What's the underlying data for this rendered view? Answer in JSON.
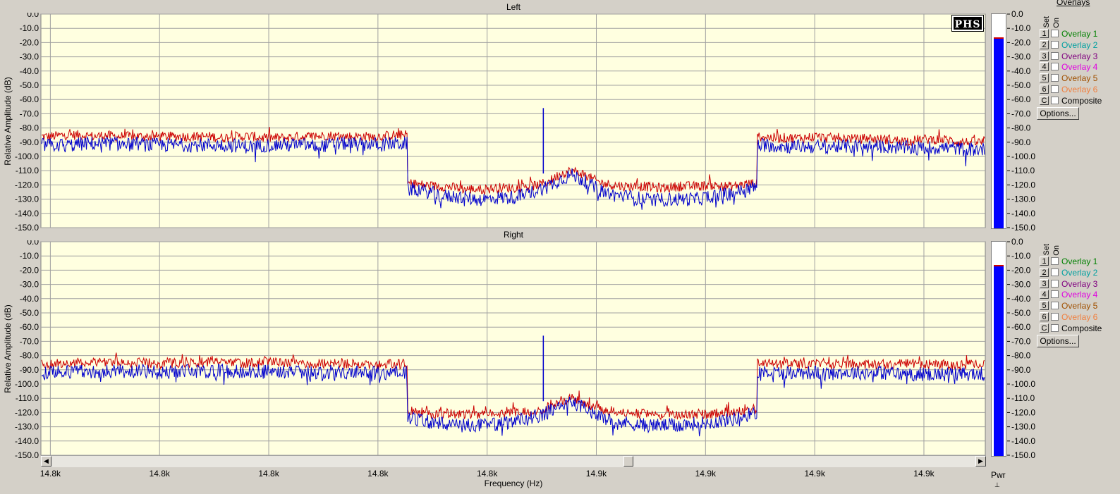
{
  "chart_data": [
    {
      "type": "line",
      "title": "Left",
      "ylabel": "Relative Amplitude (dB)",
      "ylim": [
        -150,
        0
      ],
      "yticks": [
        "0.0",
        "-10.0",
        "-20.0",
        "-30.0",
        "-40.0",
        "-50.0",
        "-60.0",
        "-70.0",
        "-80.0",
        "-90.0",
        "-100.0",
        "-110.0",
        "-120.0",
        "-130.0",
        "-140.0",
        "-150.0"
      ],
      "grid": true,
      "background": "#ffffe0",
      "series": [
        {
          "color": "#cc0000",
          "values": [
            -86,
            -86,
            -85,
            -85,
            -85,
            -86,
            -85,
            -86,
            -86,
            -86,
            -86,
            -86,
            -86,
            -86,
            -86,
            -86,
            -86,
            -87,
            -86,
            -86,
            -86,
            -87,
            -87,
            -87,
            -86,
            -86,
            -86,
            -85,
            -86,
            -86,
            -86,
            -86,
            -86,
            -85,
            -85,
            -119,
            -120,
            -121,
            -121,
            -122,
            -123,
            -123,
            -123,
            -122,
            -122,
            -122,
            -121,
            -120,
            -117,
            -112,
            -110,
            -112,
            -116,
            -119,
            -120,
            -121,
            -121,
            -121,
            -122,
            -122,
            -121,
            -121,
            -121,
            -120,
            -121,
            -121,
            -120,
            -119,
            -86,
            -87,
            -87,
            -87,
            -87,
            -86,
            -87,
            -87,
            -87,
            -88,
            -87,
            -88,
            -88,
            -89,
            -89,
            -88,
            -88,
            -88,
            -89,
            -90,
            -90,
            -90
          ]
        },
        {
          "color": "#0000cc",
          "values": [
            -92,
            -92,
            -92,
            -92,
            -91,
            -91,
            -91,
            -91,
            -92,
            -91,
            -92,
            -92,
            -92,
            -92,
            -92,
            -92,
            -92,
            -92,
            -92,
            -93,
            -93,
            -92,
            -92,
            -92,
            -92,
            -92,
            -93,
            -92,
            -91,
            -91,
            -92,
            -91,
            -92,
            -91,
            -91,
            -123,
            -124,
            -126,
            -128,
            -128,
            -129,
            -130,
            -130,
            -129,
            -129,
            -128,
            -126,
            -123,
            -120,
            -116,
            -113,
            -116,
            -121,
            -125,
            -127,
            -128,
            -129,
            -130,
            -131,
            -130,
            -130,
            -130,
            -130,
            -128,
            -127,
            -126,
            -124,
            -122,
            -92,
            -92,
            -93,
            -93,
            -93,
            -93,
            -93,
            -93,
            -93,
            -93,
            -93,
            -93,
            -93,
            -94,
            -94,
            -94,
            -94,
            -94,
            -94,
            -95,
            -95,
            -95
          ]
        }
      ],
      "spike": {
        "value": -66
      },
      "meter": {
        "level": -17.5,
        "label": "Pwr"
      },
      "overlays": {
        "title": "Overlays",
        "set_label": "Set",
        "on_label": "On",
        "items": [
          {
            "set": "1",
            "label": "Overlay 1",
            "color": "#008000"
          },
          {
            "set": "2",
            "label": "Overlay 2",
            "color": "#00a0a0"
          },
          {
            "set": "3",
            "label": "Overlay 3",
            "color": "#800080"
          },
          {
            "set": "4",
            "label": "Overlay 4",
            "color": "#e000e0"
          },
          {
            "set": "5",
            "label": "Overlay 5",
            "color": "#a05000"
          },
          {
            "set": "6",
            "label": "Overlay 6",
            "color": "#f08040"
          },
          {
            "set": "C",
            "label": "Composite",
            "color": "#000000"
          }
        ],
        "options_label": "Options..."
      },
      "logo": "PHS"
    },
    {
      "type": "line",
      "title": "Right",
      "ylabel": "Relative Amplitude (dB)",
      "ylim": [
        -150,
        0
      ],
      "yticks": [
        "0.0",
        "-10.0",
        "-20.0",
        "-30.0",
        "-40.0",
        "-50.0",
        "-60.0",
        "-70.0",
        "-80.0",
        "-90.0",
        "-100.0",
        "-110.0",
        "-120.0",
        "-130.0",
        "-140.0",
        "-150.0"
      ],
      "grid": true,
      "background": "#ffffe0",
      "series": [
        {
          "color": "#cc0000",
          "values": [
            -86,
            -86,
            -85,
            -85,
            -85,
            -84,
            -84,
            -85,
            -85,
            -85,
            -85,
            -86,
            -85,
            -85,
            -85,
            -85,
            -84,
            -84,
            -85,
            -85,
            -85,
            -85,
            -85,
            -85,
            -85,
            -86,
            -86,
            -85,
            -85,
            -86,
            -86,
            -86,
            -86,
            -86,
            -86,
            -119,
            -120,
            -121,
            -121,
            -121,
            -121,
            -121,
            -121,
            -121,
            -120,
            -120,
            -119,
            -118,
            -116,
            -112,
            -110,
            -112,
            -116,
            -118,
            -119,
            -120,
            -121,
            -121,
            -122,
            -122,
            -122,
            -122,
            -121,
            -121,
            -120,
            -120,
            -119,
            -118,
            -84,
            -86,
            -86,
            -86,
            -86,
            -86,
            -87,
            -86,
            -86,
            -86,
            -86,
            -86,
            -86,
            -86,
            -86,
            -86,
            -86,
            -86,
            -87,
            -87,
            -86,
            -86
          ]
        },
        {
          "color": "#0000cc",
          "values": [
            -92,
            -92,
            -92,
            -91,
            -91,
            -91,
            -91,
            -91,
            -91,
            -91,
            -91,
            -92,
            -92,
            -91,
            -91,
            -91,
            -91,
            -91,
            -91,
            -91,
            -91,
            -91,
            -91,
            -91,
            -92,
            -92,
            -92,
            -91,
            -92,
            -92,
            -92,
            -92,
            -92,
            -92,
            -92,
            -124,
            -126,
            -127,
            -128,
            -128,
            -129,
            -129,
            -129,
            -128,
            -127,
            -126,
            -124,
            -122,
            -119,
            -115,
            -113,
            -116,
            -120,
            -124,
            -126,
            -127,
            -128,
            -129,
            -129,
            -129,
            -129,
            -128,
            -128,
            -127,
            -126,
            -125,
            -123,
            -121,
            -91,
            -92,
            -92,
            -92,
            -92,
            -92,
            -93,
            -92,
            -92,
            -92,
            -92,
            -92,
            -92,
            -93,
            -93,
            -93,
            -93,
            -93,
            -93,
            -93,
            -93,
            -93
          ]
        }
      ],
      "spike": {
        "value": -66
      },
      "meter": {
        "level": -17.5,
        "label": "Pwr"
      },
      "overlays": {
        "title": "",
        "set_label": "Set",
        "on_label": "On",
        "items": [
          {
            "set": "1",
            "label": "Overlay 1",
            "color": "#008000"
          },
          {
            "set": "2",
            "label": "Overlay 2",
            "color": "#00a0a0"
          },
          {
            "set": "3",
            "label": "Overlay 3",
            "color": "#800080"
          },
          {
            "set": "4",
            "label": "Overlay 4",
            "color": "#e000e0"
          },
          {
            "set": "5",
            "label": "Overlay 5",
            "color": "#a05000"
          },
          {
            "set": "6",
            "label": "Overlay 6",
            "color": "#f08040"
          },
          {
            "set": "C",
            "label": "Composite",
            "color": "#000000"
          }
        ],
        "options_label": "Options..."
      }
    }
  ],
  "xaxis": {
    "label": "Frequency (Hz)",
    "ticks": [
      "14.8k",
      "14.8k",
      "14.8k",
      "14.8k",
      "14.8k",
      "14.9k",
      "14.9k",
      "14.9k",
      "14.9k"
    ],
    "first_tick_pos": 0.01,
    "last_tick_pos": 0.935
  },
  "meter_label": "Pwr"
}
